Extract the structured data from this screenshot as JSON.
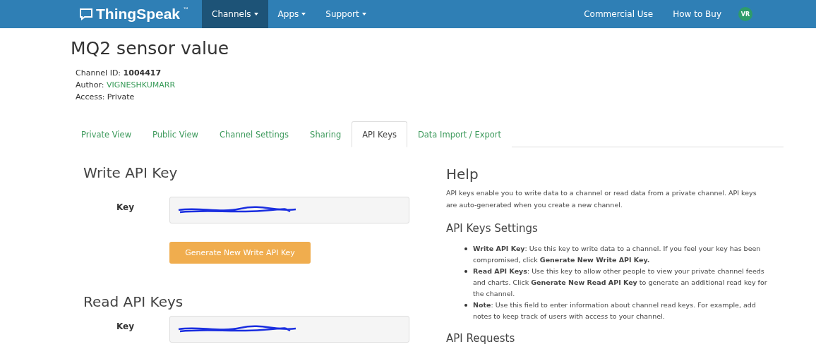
{
  "navbar": {
    "logo": "ThingSpeak",
    "trademark": "™",
    "menu": [
      {
        "label": "Channels",
        "selected": true,
        "dropdown": true
      },
      {
        "label": "Apps",
        "selected": false,
        "dropdown": true
      },
      {
        "label": "Support",
        "selected": false,
        "dropdown": true
      }
    ],
    "right_links": [
      "Commercial Use",
      "How to Buy"
    ],
    "avatar": "VR"
  },
  "channel": {
    "title": "MQ2 sensor value",
    "meta": [
      {
        "label": "Channel ID: ",
        "value": "1004417",
        "kind": "bold"
      },
      {
        "label": "Author: ",
        "value": "VIGNESHKUMARR",
        "kind": "link"
      },
      {
        "label": "Access: ",
        "value": "Private",
        "kind": "plain"
      }
    ]
  },
  "tabs": [
    {
      "label": "Private View",
      "selected": false
    },
    {
      "label": "Public View",
      "selected": false
    },
    {
      "label": "Channel Settings",
      "selected": false
    },
    {
      "label": "Sharing",
      "selected": false
    },
    {
      "label": "API Keys",
      "selected": true
    },
    {
      "label": "Data Import / Export",
      "selected": false
    }
  ],
  "write_key": {
    "heading": "Write API Key",
    "field_label": "Key",
    "redacted": true,
    "button": "Generate New Write API Key"
  },
  "read_keys": {
    "heading": "Read API Keys",
    "field_label": "Key",
    "redacted": true
  },
  "help": {
    "heading": "Help",
    "intro": "API keys enable you to write data to a channel or read data from a private channel. API keys are auto-generated when you create a new channel.",
    "settings_heading": "API Keys Settings",
    "bullets": [
      "**Write API Key**: Use this key to write data to a channel. If you feel your key has been compromised, click **Generate New Write API Key.**",
      "**Read API Keys**: Use this key to allow other people to view your private channel feeds and charts. Click **Generate New Read API Key** to generate an additional read key for the channel.",
      "**Note**: Use this field to enter information about channel read keys. For example, add notes to keep track of users with access to your channel."
    ],
    "requests_heading": "API Requests"
  }
}
